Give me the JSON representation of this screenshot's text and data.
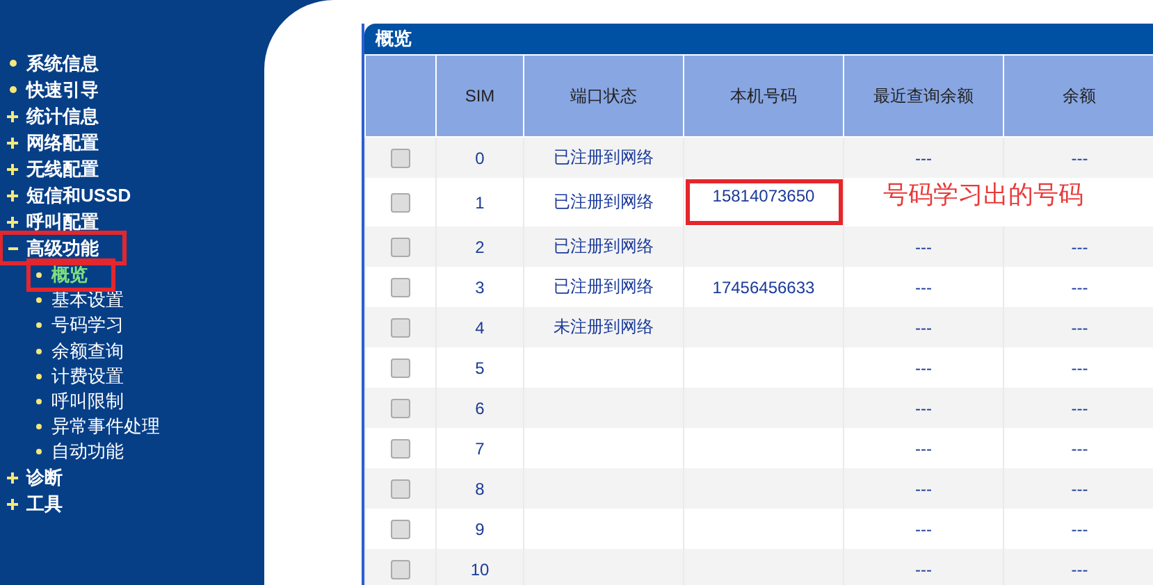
{
  "sidebar": {
    "items": [
      {
        "label": "系统信息",
        "kind": "link",
        "highlighted": false
      },
      {
        "label": "快速引导",
        "kind": "link",
        "highlighted": false
      },
      {
        "label": "统计信息",
        "kind": "group",
        "expanded": false,
        "highlighted": false
      },
      {
        "label": "网络配置",
        "kind": "group",
        "expanded": false,
        "highlighted": false
      },
      {
        "label": "无线配置",
        "kind": "group",
        "expanded": false,
        "highlighted": false
      },
      {
        "label": "短信和USSD",
        "kind": "group",
        "expanded": false,
        "highlighted": false
      },
      {
        "label": "呼叫配置",
        "kind": "group",
        "expanded": false,
        "highlighted": false
      },
      {
        "label": "高级功能",
        "kind": "group",
        "expanded": true,
        "highlighted": true,
        "children": [
          {
            "label": "概览",
            "selected": true,
            "highlighted": true
          },
          {
            "label": "基本设置",
            "selected": false,
            "highlighted": false
          },
          {
            "label": "号码学习",
            "selected": false,
            "highlighted": false
          },
          {
            "label": "余额查询",
            "selected": false,
            "highlighted": false
          },
          {
            "label": "计费设置",
            "selected": false,
            "highlighted": false
          },
          {
            "label": "呼叫限制",
            "selected": false,
            "highlighted": false
          },
          {
            "label": "异常事件处理",
            "selected": false,
            "highlighted": false
          },
          {
            "label": "自动功能",
            "selected": false,
            "highlighted": false
          }
        ]
      },
      {
        "label": "诊断",
        "kind": "group",
        "expanded": false,
        "highlighted": false
      },
      {
        "label": "工具",
        "kind": "group",
        "expanded": false,
        "highlighted": false
      }
    ]
  },
  "panel": {
    "title": "概览",
    "table": {
      "columns": [
        "SIM",
        "端口状态",
        "本机号码",
        "最近查询余额",
        "余额"
      ],
      "rows": [
        {
          "checked": false,
          "sim": "0",
          "status": "已注册到网络",
          "recent_balance": "---",
          "balance": "---"
        },
        {
          "checked": false,
          "sim": "1",
          "status": "已注册到网络",
          "number": "15814073650",
          "number_highlighted": true,
          "note": "号码学习出的号码"
        },
        {
          "checked": false,
          "sim": "2",
          "status": "已注册到网络",
          "recent_balance": "---",
          "balance": "---"
        },
        {
          "checked": false,
          "sim": "3",
          "status": "已注册到网络",
          "number": "17456456633",
          "recent_balance": "---",
          "balance": "---"
        },
        {
          "checked": false,
          "sim": "4",
          "status": "未注册到网络",
          "recent_balance": "---",
          "balance": "---"
        },
        {
          "checked": false,
          "sim": "5",
          "recent_balance": "---",
          "balance": "---"
        },
        {
          "checked": false,
          "sim": "6",
          "recent_balance": "---",
          "balance": "---"
        },
        {
          "checked": false,
          "sim": "7",
          "recent_balance": "---",
          "balance": "---"
        },
        {
          "checked": false,
          "sim": "8",
          "recent_balance": "---",
          "balance": "---"
        },
        {
          "checked": false,
          "sim": "9",
          "recent_balance": "---",
          "balance": "---"
        },
        {
          "checked": false,
          "sim": "10",
          "recent_balance": "---",
          "balance": "---"
        }
      ]
    }
  }
}
